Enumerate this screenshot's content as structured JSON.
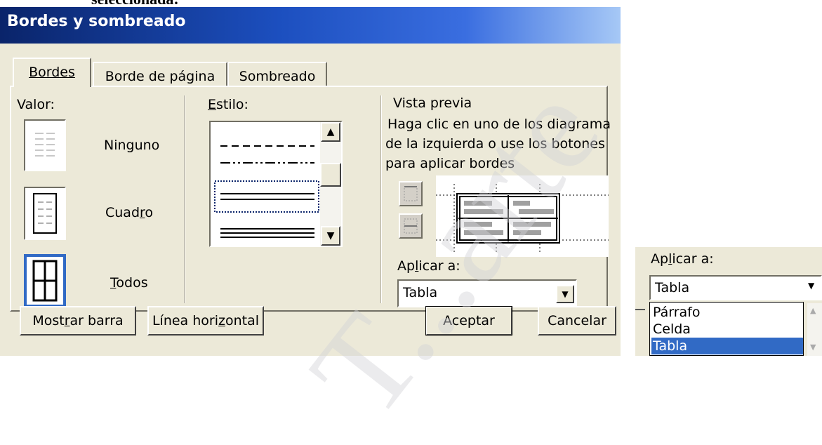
{
  "document": {
    "heading": "seleccionada:"
  },
  "window": {
    "title": "Bordes y sombreado"
  },
  "tabs": [
    "Bordes",
    "Borde de página",
    "Sombreado"
  ],
  "valor": {
    "label": "Valor:",
    "options": [
      "Ninguno",
      "Cuadro",
      "Todos"
    ],
    "selected": "Todos"
  },
  "estilo": {
    "label": "Estilo:"
  },
  "preview": {
    "label": "Vista previa",
    "instructions": [
      "Haga clic en uno de los diagrama",
      "de la izquierda o use los botones",
      "para aplicar bordes"
    ]
  },
  "apply": {
    "label": "Aplicar a:",
    "value": "Tabla"
  },
  "buttons": {
    "show_toolbar": "Mostrar barra",
    "horizontal_line": "Línea horizontal",
    "ok": "Aceptar",
    "cancel": "Cancelar"
  },
  "dropdown_example": {
    "label": "Aplicar a:",
    "value": "Tabla",
    "options": [
      "Párrafo",
      "Celda",
      "Tabla"
    ],
    "highlighted": "Tabla"
  },
  "watermark": "T...arte",
  "colors": {
    "title_bar": "#0a246a",
    "dialog": "#ece9d8",
    "selection": "#316ac5"
  }
}
